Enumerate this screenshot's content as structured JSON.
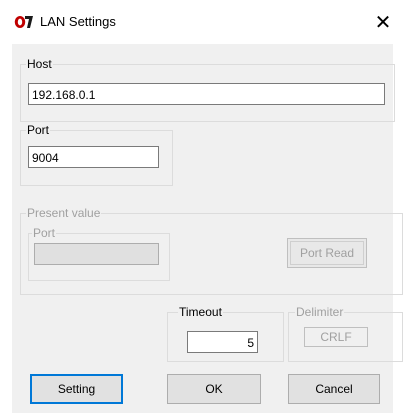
{
  "window": {
    "title": "LAN Settings",
    "logo_icon": "app-logo-icon",
    "close_glyph": "✕",
    "logo_color": "#c00000"
  },
  "host_group": {
    "label": "Host",
    "value": "192.168.0.1"
  },
  "port_group": {
    "label": "Port",
    "value": "9004"
  },
  "present_value_group": {
    "label": "Present value",
    "port_label": "Port",
    "port_value": "",
    "port_read_button": "Port Read"
  },
  "timeout_group": {
    "label": "Timeout",
    "value": "5"
  },
  "delimiter_group": {
    "label": "Delimiter",
    "value": "CRLF"
  },
  "buttons": {
    "setting": "Setting",
    "ok": "OK",
    "cancel": "Cancel"
  },
  "colors": {
    "focus_border": "#0078d7",
    "dialog_bg": "#f0f0f0"
  }
}
